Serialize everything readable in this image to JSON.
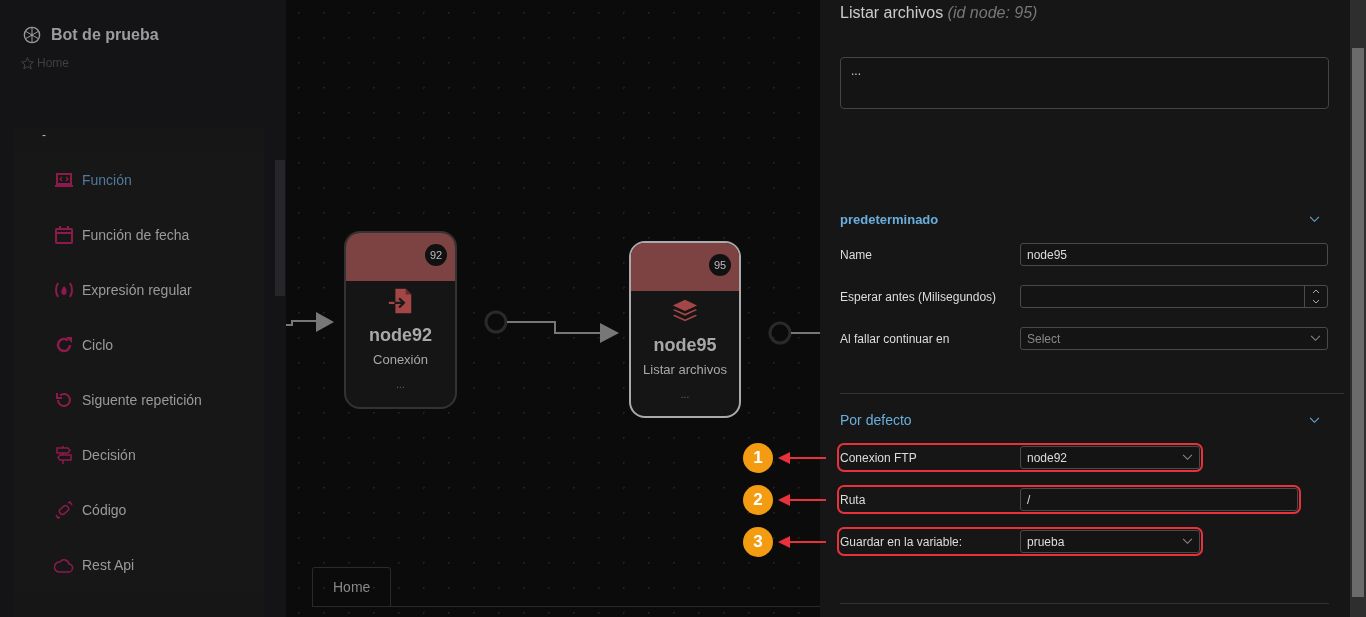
{
  "sidebar": {
    "title": "Bot de prueba",
    "breadcrumb": "Home",
    "group_label": "-",
    "items": [
      {
        "label": "Función",
        "kind": "function",
        "selected": true
      },
      {
        "label": "Función de fecha",
        "kind": "date",
        "selected": false
      },
      {
        "label": "Expresión regular",
        "kind": "regex",
        "selected": false
      },
      {
        "label": "Ciclo",
        "kind": "loop",
        "selected": false
      },
      {
        "label": "Siguente repetición",
        "kind": "next",
        "selected": false
      },
      {
        "label": "Decisión",
        "kind": "decision",
        "selected": false
      },
      {
        "label": "Código",
        "kind": "code",
        "selected": false
      },
      {
        "label": "Rest Api",
        "kind": "api",
        "selected": false
      }
    ]
  },
  "canvas": {
    "nodes": [
      {
        "name": "node92",
        "type": "Conexión",
        "badge": "92",
        "kind": "connection",
        "more": "...",
        "selected": false
      },
      {
        "name": "node95",
        "type": "Listar archivos",
        "badge": "95",
        "kind": "list",
        "more": "...",
        "selected": true
      }
    ],
    "tabs": [
      {
        "label": "Home",
        "selected": true
      }
    ]
  },
  "panel": {
    "title": "Listar archivos",
    "title_suffix": "(id node: 95)",
    "description": "...",
    "sections": [
      {
        "title": "predeterminado",
        "expanded": true,
        "fields": [
          {
            "kind": "text",
            "label": "Name",
            "value": "node95"
          },
          {
            "kind": "number",
            "label": "Esperar antes (Milisegundos)"
          },
          {
            "kind": "select",
            "label": "Al fallar continuar en",
            "placeholder": "Select"
          }
        ]
      },
      {
        "title": "Por defecto",
        "expanded": true,
        "fields": [
          {
            "kind": "select",
            "label": "Conexion FTP",
            "value": "node92",
            "annotation": "1"
          },
          {
            "kind": "text",
            "label": "Ruta",
            "value": "/",
            "annotation": "2"
          },
          {
            "kind": "select",
            "label": "Guardar en la variable:",
            "value": "prueba",
            "annotation": "3"
          }
        ]
      }
    ]
  }
}
